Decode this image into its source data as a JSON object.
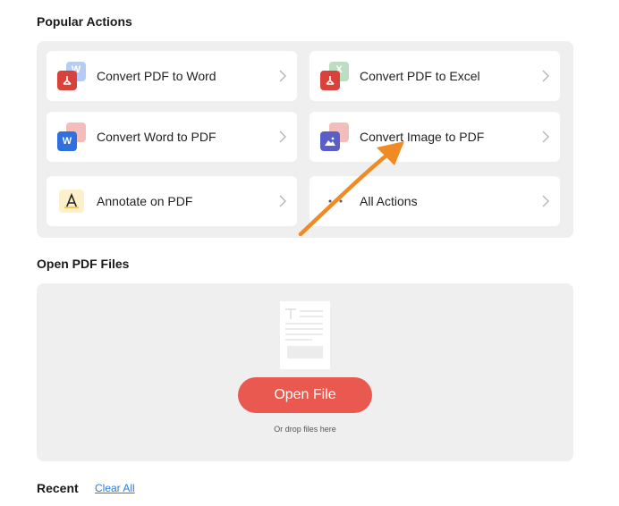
{
  "popular": {
    "title": "Popular Actions",
    "actions": [
      {
        "label": "Convert PDF to Word",
        "icon": "pdf-to-word-icon"
      },
      {
        "label": "Convert PDF to Excel",
        "icon": "pdf-to-excel-icon"
      },
      {
        "label": "Convert Word to PDF",
        "icon": "word-to-pdf-icon"
      },
      {
        "label": "Convert Image to PDF",
        "icon": "image-to-pdf-icon"
      },
      {
        "label": "Annotate on PDF",
        "icon": "annotate-icon"
      },
      {
        "label": "All Actions",
        "icon": "all-actions-icon"
      }
    ]
  },
  "open_files": {
    "title": "Open PDF Files",
    "button_label": "Open File",
    "drop_hint": "Or drop files here"
  },
  "recent": {
    "title": "Recent",
    "clear_label": "Clear All"
  },
  "colors": {
    "pdf_red": "#d9423a",
    "word_blue": "#2f6fe0",
    "excel_green": "#3fa34d",
    "image_purple": "#5a5fc8",
    "annotate_yellow": "#f6c94a",
    "open_button": "#e9594f",
    "link_blue": "#2e7bd6",
    "arrow_orange": "#f08a24"
  }
}
